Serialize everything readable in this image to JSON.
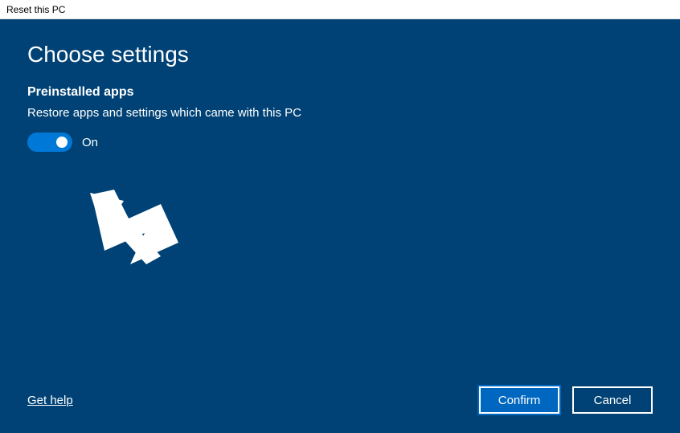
{
  "window": {
    "title": "Reset this PC"
  },
  "page": {
    "title": "Choose settings"
  },
  "section": {
    "preinstalled_apps": {
      "title": "Preinstalled apps",
      "description": "Restore apps and settings which came with this PC",
      "toggle_state": "On",
      "toggle_on": true
    }
  },
  "footer": {
    "help_label": "Get help",
    "confirm_label": "Confirm",
    "cancel_label": "Cancel"
  },
  "colors": {
    "panel_bg": "#004275",
    "accent": "#0078D7",
    "button_primary": "#0067C0"
  }
}
